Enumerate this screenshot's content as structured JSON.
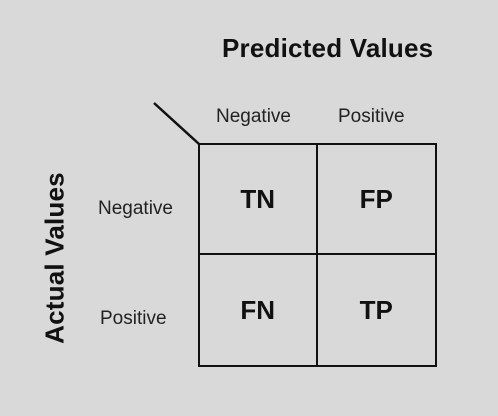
{
  "predicted_title": "Predicted Values",
  "actual_title": "Actual Values",
  "columns": [
    "Negative",
    "Positive"
  ],
  "rows": [
    "Negative",
    "Positive"
  ],
  "cells": [
    [
      "TN",
      "FP"
    ],
    [
      "FN",
      "TP"
    ]
  ]
}
